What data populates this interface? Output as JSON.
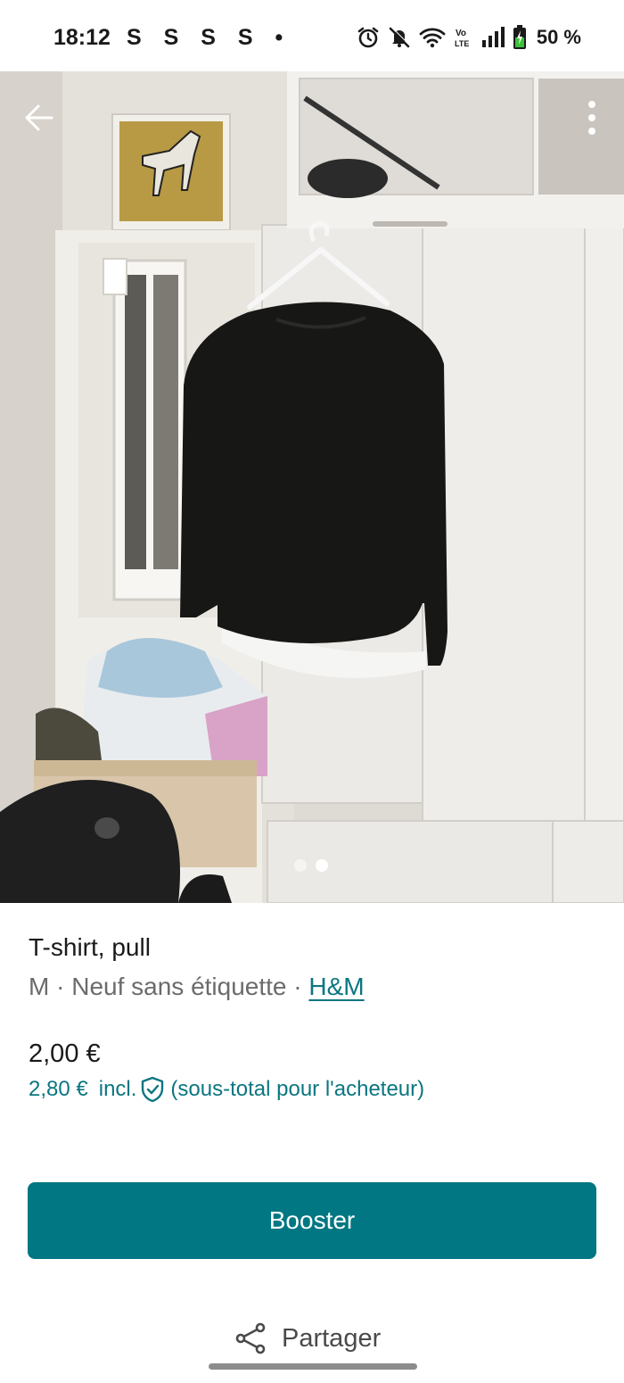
{
  "status_bar": {
    "time": "18:12",
    "notification_icons": "S S S S •",
    "battery": "50 %",
    "icons": [
      "alarm-icon",
      "mute-icon",
      "wifi-icon",
      "volte-icon",
      "signal-icon",
      "battery-charging-icon"
    ]
  },
  "gallery": {
    "photo_subject": "black long-sleeve top on white hanger",
    "pages": 2,
    "current_page": 2
  },
  "item": {
    "title": "T-shirt, pull",
    "size": "M",
    "condition": "Neuf sans étiquette",
    "separator": "·",
    "brand": "H&M"
  },
  "pricing": {
    "price": "2,00 €",
    "total_price": "2,80 €",
    "incl_label": "incl.",
    "buyer_note": "(sous-total pour l'acheteur)"
  },
  "actions": {
    "booster_label": "Booster",
    "share_label": "Partager"
  },
  "colors": {
    "accent": "#007782",
    "link": "#0b7680"
  }
}
